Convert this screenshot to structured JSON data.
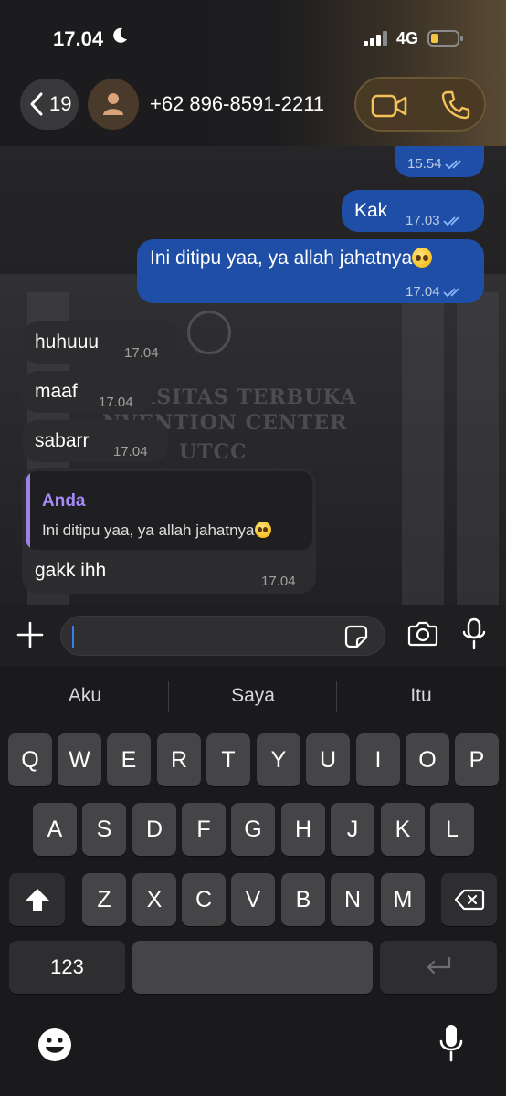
{
  "status_bar": {
    "time": "17.04",
    "network": "4G"
  },
  "header": {
    "back_count": "19",
    "contact_name": "+62 896-8591-2211"
  },
  "wallpaper_text": {
    "line1": "RSITAS TERBUKA",
    "line2": "NVENTION CENTER",
    "line3": "UTCC"
  },
  "messages": [
    {
      "direction": "out",
      "text": "",
      "time": "15.54",
      "status": "read"
    },
    {
      "direction": "out",
      "text": "Kak",
      "time": "17.03",
      "status": "read"
    },
    {
      "direction": "out",
      "text": "Ini ditipu yaa, ya allah jahatnya",
      "emoji": "pleading-face",
      "time": "17.04",
      "status": "read"
    },
    {
      "direction": "in",
      "text": "huhuuu",
      "time": "17.04"
    },
    {
      "direction": "in",
      "text": "maaf",
      "time": "17.04"
    },
    {
      "direction": "in",
      "text": "sabarr",
      "time": "17.04"
    },
    {
      "direction": "in",
      "text": "gakk ihh",
      "time": "17.04",
      "reply_to": {
        "author": "Anda",
        "text": "Ini ditipu yaa, ya allah jahatnya",
        "emoji": "pleading-face"
      }
    }
  ],
  "input": {
    "placeholder": "",
    "value": ""
  },
  "keyboard": {
    "suggestions": [
      "Aku",
      "Saya",
      "Itu"
    ],
    "row1": [
      "Q",
      "W",
      "E",
      "R",
      "T",
      "Y",
      "U",
      "I",
      "O",
      "P"
    ],
    "row2": [
      "A",
      "S",
      "D",
      "F",
      "G",
      "H",
      "J",
      "K",
      "L"
    ],
    "row3": [
      "Z",
      "X",
      "C",
      "V",
      "B",
      "N",
      "M"
    ],
    "numbers_label": "123"
  },
  "colors": {
    "outgoing_bubble": "#1e4ea5",
    "incoming_bubble": "#2c2c2e",
    "reply_accent": "#a78bfa",
    "read_ticks": "#8fb6ff"
  },
  "icons": [
    "moon-icon",
    "signal-icon",
    "battery-icon",
    "chevron-left-icon",
    "person-icon",
    "video-call-icon",
    "phone-icon",
    "plus-icon",
    "sticker-icon",
    "camera-icon",
    "microphone-icon",
    "shift-icon",
    "delete-icon",
    "return-icon",
    "emoji-icon",
    "dictation-icon"
  ]
}
